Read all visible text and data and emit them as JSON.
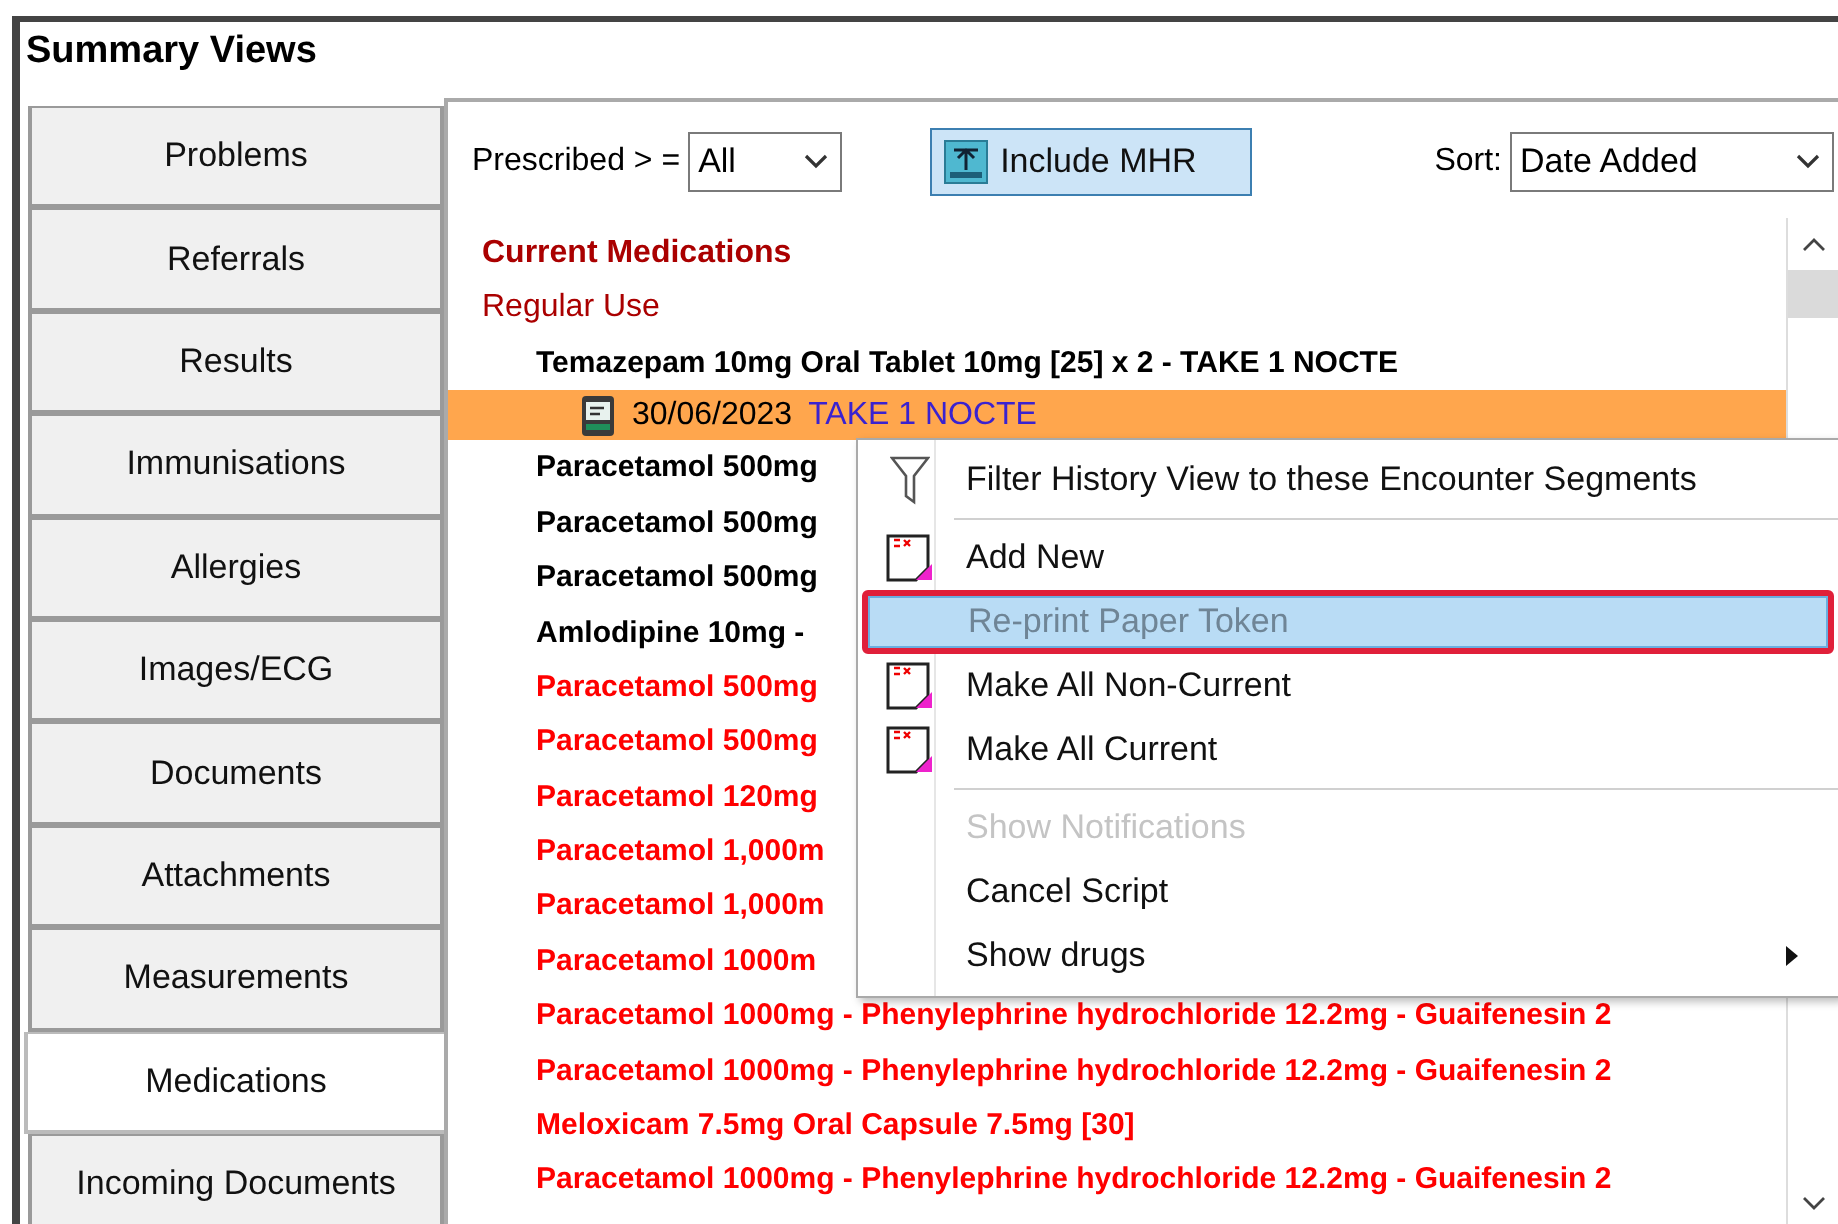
{
  "window": {
    "title": "Summary Views"
  },
  "tabs": [
    {
      "label": "Problems",
      "selected": false
    },
    {
      "label": "Referrals",
      "selected": false
    },
    {
      "label": "Results",
      "selected": false
    },
    {
      "label": "Immunisations",
      "selected": false
    },
    {
      "label": "Allergies",
      "selected": false
    },
    {
      "label": "Images/ECG",
      "selected": false
    },
    {
      "label": "Documents",
      "selected": false
    },
    {
      "label": "Attachments",
      "selected": false
    },
    {
      "label": "Measurements",
      "selected": false
    },
    {
      "label": "Medications",
      "selected": true
    },
    {
      "label": "Incoming Documents",
      "selected": false
    }
  ],
  "toolbar": {
    "prescribed_label": "Prescribed > =",
    "prescribed_value": "All",
    "mhr_button": "Include MHR",
    "sort_label": "Sort:",
    "sort_value": "Date Added"
  },
  "medications": {
    "heading": "Current Medications",
    "subgroups": [
      {
        "heading": "Regular Use",
        "drugs": [
          {
            "name": "Temazepam 10mg Oral Tablet 10mg [25] x 2 - TAKE 1 NOCTE",
            "color": "#000000",
            "selected": false,
            "children": [
              {
                "date": "30/06/2023",
                "instruction": "TAKE 1 NOCTE",
                "selected": true
              }
            ]
          },
          {
            "name": "Paracetamol 500mg",
            "color": "#000000",
            "selected": false
          },
          {
            "name": "Paracetamol 500mg",
            "color": "#000000",
            "selected": false
          },
          {
            "name": "Paracetamol 500mg",
            "color": "#000000",
            "selected": false
          },
          {
            "name": "Amlodipine 10mg -",
            "color": "#000000",
            "selected": false
          },
          {
            "name": "Paracetamol 500mg",
            "color": "#ff0000",
            "selected": false
          },
          {
            "name": "Paracetamol 500mg",
            "color": "#ff0000",
            "selected": false
          },
          {
            "name": "Paracetamol 120mg",
            "color": "#ff0000",
            "selected": false
          },
          {
            "name": "Paracetamol 1,000m",
            "color": "#ff0000",
            "selected": false
          },
          {
            "name": "Paracetamol 1,000m",
            "color": "#ff0000",
            "selected": false
          },
          {
            "name": "Paracetamol 1000m",
            "color": "#ff0000",
            "selected": false
          },
          {
            "name": "Paracetamol 1000mg - Phenylephrine hydrochloride 12.2mg - Guaifenesin 2",
            "color": "#ff0000",
            "selected": false
          },
          {
            "name": "Paracetamol 1000mg - Phenylephrine hydrochloride 12.2mg - Guaifenesin 2",
            "color": "#ff0000",
            "selected": false
          },
          {
            "name": "Meloxicam 7.5mg Oral Capsule 7.5mg [30]",
            "color": "#ff0000",
            "selected": false
          },
          {
            "name": "Paracetamol 1000mg - Phenylephrine hydrochloride 12.2mg - Guaifenesin 2",
            "color": "#ff0000",
            "selected": false
          }
        ]
      }
    ]
  },
  "context_menu": [
    {
      "kind": "filter",
      "label": "Filter History View to these Encounter Segments",
      "disabled": false,
      "highlighted": false
    },
    {
      "kind": "separator"
    },
    {
      "kind": "rx",
      "label": "Add New",
      "disabled": false,
      "highlighted": false
    },
    {
      "kind": "plain",
      "label": "Re-print Paper Token",
      "disabled": true,
      "highlighted": true
    },
    {
      "kind": "rx",
      "label": "Make All Non-Current",
      "disabled": false,
      "highlighted": false
    },
    {
      "kind": "rx",
      "label": "Make All Current",
      "disabled": false,
      "highlighted": false
    },
    {
      "kind": "separator"
    },
    {
      "kind": "plain",
      "label": "Show Notifications",
      "disabled": true,
      "highlighted": false
    },
    {
      "kind": "plain",
      "label": "Cancel Script",
      "disabled": false,
      "highlighted": false
    },
    {
      "kind": "submenu",
      "label": "Show drugs",
      "disabled": false,
      "highlighted": false
    }
  ]
}
